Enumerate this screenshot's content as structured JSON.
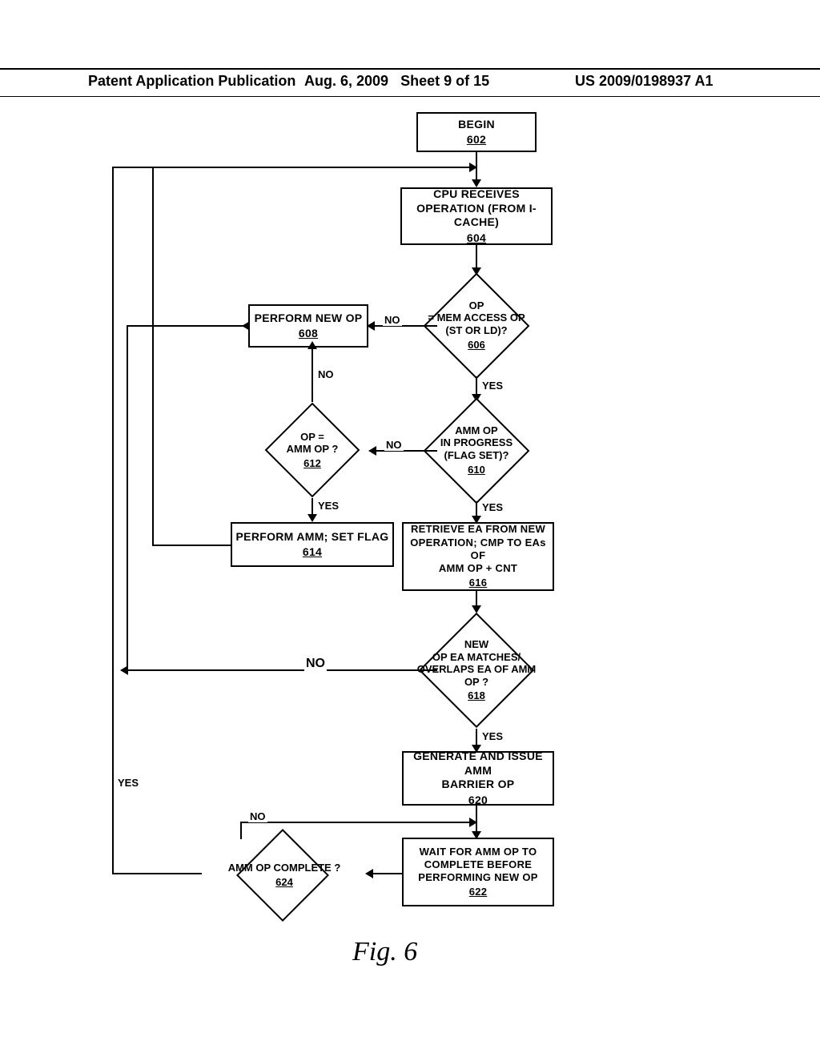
{
  "header": {
    "left": "Patent Application Publication",
    "date": "Aug. 6, 2009",
    "sheet": "Sheet 9 of 15",
    "pubno": "US 2009/0198937 A1"
  },
  "fig_caption": "Fig. 6",
  "nodes": {
    "begin": {
      "text": "BEGIN",
      "ref": "602"
    },
    "recv": {
      "text": "CPU RECEIVES OPERATION (FROM I-CACHE)",
      "ref": "604"
    },
    "isMem": {
      "text": "OP = MEM ACCESS OP (ST OR LD)?",
      "ref": "606"
    },
    "newop": {
      "text": "PERFORM NEW OP",
      "ref": "608"
    },
    "inProg": {
      "text": "AMM OP IN PROGRESS (FLAG SET)?",
      "ref": "610"
    },
    "isAmm": {
      "text": "OP = AMM OP ?",
      "ref": "612"
    },
    "doAmm": {
      "text": "PERFORM AMM; SET FLAG",
      "ref": "614"
    },
    "retrv": {
      "text": "RETRIEVE EA FROM NEW OPERATION; CMP TO EAs OF AMM OP + CNT",
      "ref": "616"
    },
    "match": {
      "text": "NEW OP EA MATCHES/ OVERLAPS EA OF AMM OP ?",
      "ref": "618"
    },
    "gen": {
      "text": "GENERATE AND ISSUE AMM BARRIER OP",
      "ref": "620"
    },
    "wait": {
      "text": "WAIT FOR AMM OP TO COMPLETE BEFORE PERFORMING NEW OP",
      "ref": "622"
    },
    "comp": {
      "text": "AMM OP COMPLETE ?",
      "ref": "624"
    }
  },
  "labels": {
    "yes": "YES",
    "no": "NO"
  }
}
